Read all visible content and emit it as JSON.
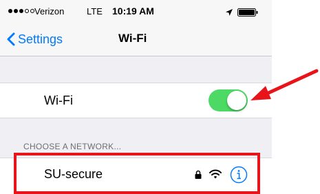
{
  "status_bar": {
    "carrier": "Verizon",
    "network_type": "LTE",
    "time": "10:19 AM",
    "signal_bars_filled": 3,
    "signal_bars_total": 5
  },
  "nav": {
    "back_label": "Settings",
    "title": "Wi-Fi"
  },
  "wifi_toggle": {
    "label": "Wi-Fi",
    "state": "on"
  },
  "networks": {
    "section_header": "CHOOSE A NETWORK...",
    "items": [
      {
        "name": "SU-secure",
        "secured": true,
        "icons": [
          "lock-icon",
          "wifi-signal-icon",
          "info-icon"
        ]
      }
    ]
  },
  "annotations": {
    "highlight_color": "#e8141a",
    "arrow_color": "#e8141a"
  },
  "colors": {
    "ios_blue": "#007aff",
    "toggle_on_green": "#4cd964",
    "background_gray": "#efeff4",
    "section_header_gray": "#6d6d72"
  }
}
